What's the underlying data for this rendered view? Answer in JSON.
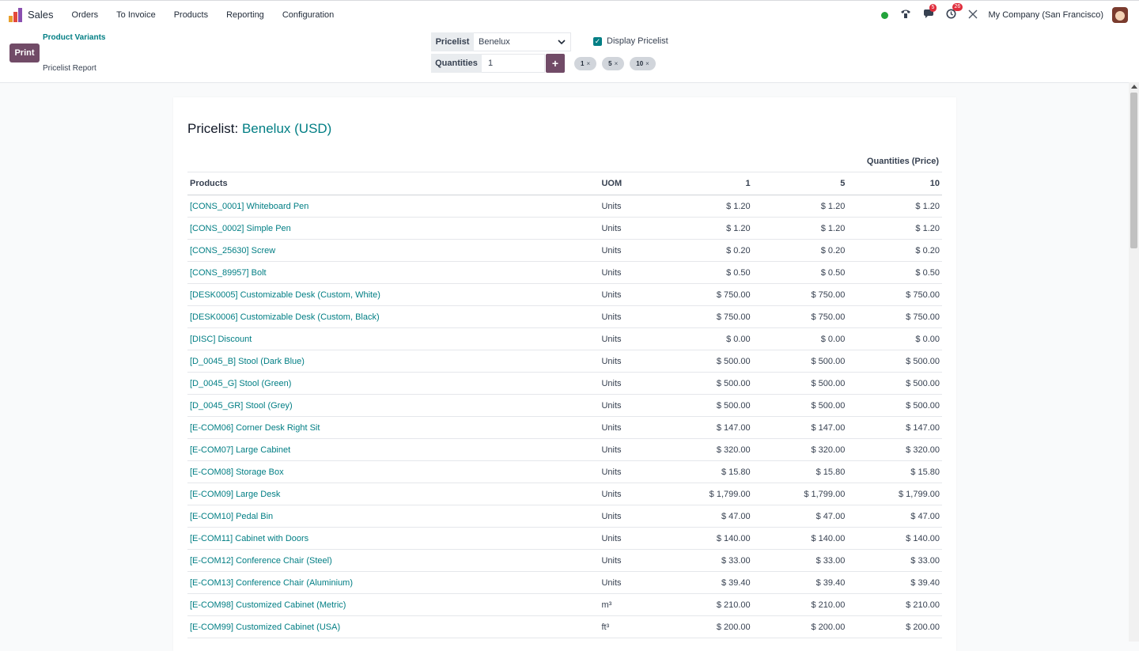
{
  "nav": {
    "app_name": "Sales",
    "menu": [
      "Orders",
      "To Invoice",
      "Products",
      "Reporting",
      "Configuration"
    ],
    "messages_count": "5",
    "activities_count": "26",
    "company": "My Company (San Francisco)"
  },
  "control": {
    "print_label": "Print",
    "print_options": [
      "Product Variants",
      "Pricelist Report"
    ],
    "pricelist_label": "Pricelist",
    "pricelist_value": "Benelux",
    "quantities_label": "Quantities",
    "quantities_value": "1",
    "display_pricelist_label": "Display Pricelist",
    "display_pricelist_checked": true,
    "quantity_tags": [
      "1",
      "5",
      "10"
    ]
  },
  "report": {
    "title_prefix": "Pricelist:",
    "pricelist_name": "Benelux (USD)",
    "qty_caption": "Quantities (Price)",
    "headers": [
      "Products",
      "UOM",
      "1",
      "5",
      "10"
    ],
    "rows": [
      [
        "[CONS_0001] Whiteboard Pen",
        "Units",
        "$ 1.20",
        "$ 1.20",
        "$ 1.20"
      ],
      [
        "[CONS_0002] Simple Pen",
        "Units",
        "$ 1.20",
        "$ 1.20",
        "$ 1.20"
      ],
      [
        "[CONS_25630] Screw",
        "Units",
        "$ 0.20",
        "$ 0.20",
        "$ 0.20"
      ],
      [
        "[CONS_89957] Bolt",
        "Units",
        "$ 0.50",
        "$ 0.50",
        "$ 0.50"
      ],
      [
        "[DESK0005] Customizable Desk (Custom, White)",
        "Units",
        "$ 750.00",
        "$ 750.00",
        "$ 750.00"
      ],
      [
        "[DESK0006] Customizable Desk (Custom, Black)",
        "Units",
        "$ 750.00",
        "$ 750.00",
        "$ 750.00"
      ],
      [
        "[DISC] Discount",
        "Units",
        "$ 0.00",
        "$ 0.00",
        "$ 0.00"
      ],
      [
        "[D_0045_B] Stool (Dark Blue)",
        "Units",
        "$ 500.00",
        "$ 500.00",
        "$ 500.00"
      ],
      [
        "[D_0045_G] Stool (Green)",
        "Units",
        "$ 500.00",
        "$ 500.00",
        "$ 500.00"
      ],
      [
        "[D_0045_GR] Stool (Grey)",
        "Units",
        "$ 500.00",
        "$ 500.00",
        "$ 500.00"
      ],
      [
        "[E-COM06] Corner Desk Right Sit",
        "Units",
        "$ 147.00",
        "$ 147.00",
        "$ 147.00"
      ],
      [
        "[E-COM07] Large Cabinet",
        "Units",
        "$ 320.00",
        "$ 320.00",
        "$ 320.00"
      ],
      [
        "[E-COM08] Storage Box",
        "Units",
        "$ 15.80",
        "$ 15.80",
        "$ 15.80"
      ],
      [
        "[E-COM09] Large Desk",
        "Units",
        "$ 1,799.00",
        "$ 1,799.00",
        "$ 1,799.00"
      ],
      [
        "[E-COM10] Pedal Bin",
        "Units",
        "$ 47.00",
        "$ 47.00",
        "$ 47.00"
      ],
      [
        "[E-COM11] Cabinet with Doors",
        "Units",
        "$ 140.00",
        "$ 140.00",
        "$ 140.00"
      ],
      [
        "[E-COM12] Conference Chair (Steel)",
        "Units",
        "$ 33.00",
        "$ 33.00",
        "$ 33.00"
      ],
      [
        "[E-COM13] Conference Chair (Aluminium)",
        "Units",
        "$ 39.40",
        "$ 39.40",
        "$ 39.40"
      ],
      [
        "[E-COM98] Customized Cabinet (Metric)",
        "m³",
        "$ 210.00",
        "$ 210.00",
        "$ 210.00"
      ],
      [
        "[E-COM99] Customized Cabinet (USA)",
        "ft³",
        "$ 200.00",
        "$ 200.00",
        "$ 200.00"
      ]
    ]
  },
  "colors": {
    "brand": "#714b67",
    "accent": "#017e84",
    "online": "#22a33b",
    "badge": "#e02d3c"
  }
}
